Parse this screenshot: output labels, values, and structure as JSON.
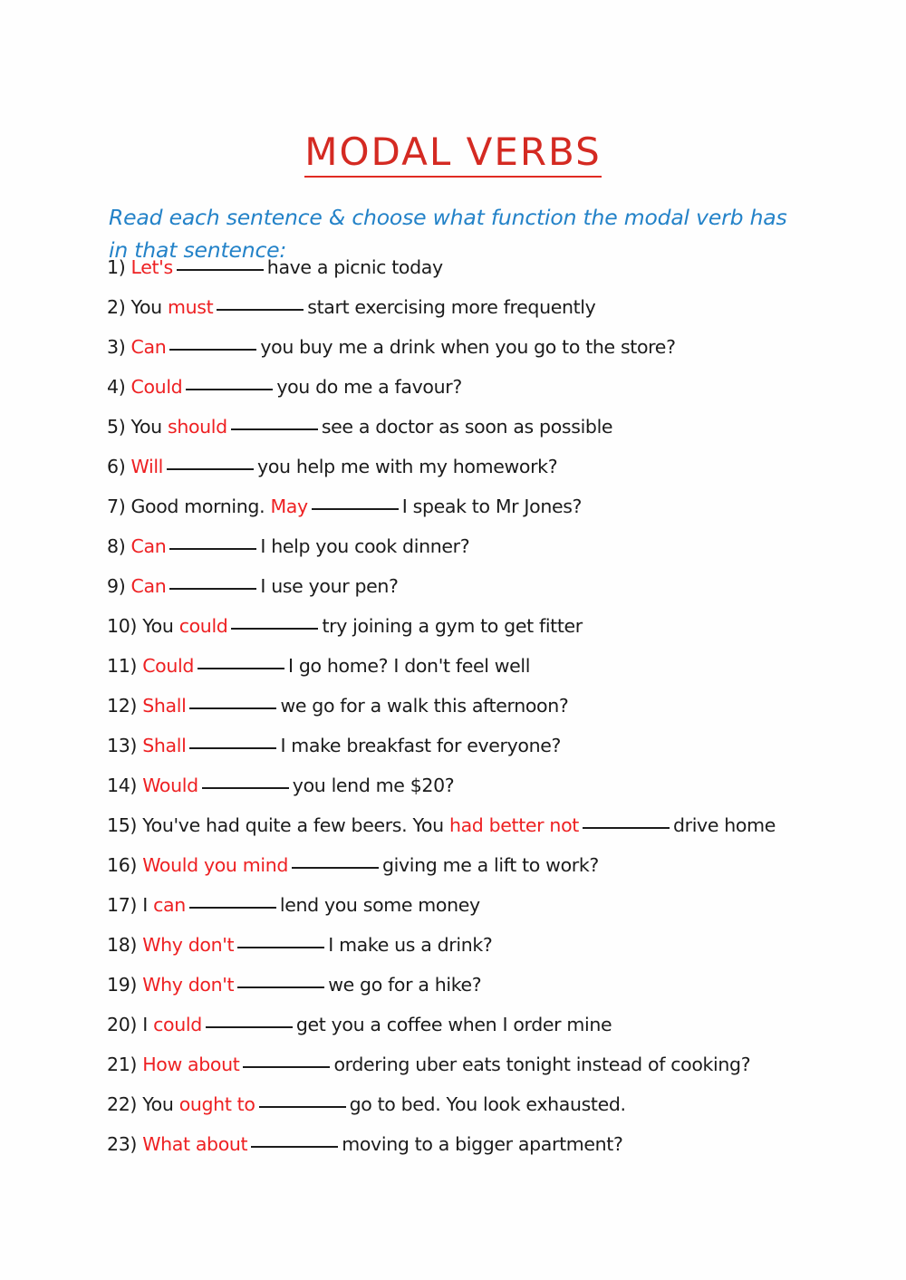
{
  "document": {
    "title": "MODAL VERBS",
    "instructions": "Read each sentence & choose what function the modal verb has in that sentence:",
    "colors": {
      "title_red": "#d42a22",
      "modal_red": "#ee2022",
      "instruction_blue": "#2382c8",
      "body_black": "#1b1b1b",
      "page_background": "#fefefe"
    },
    "blank_placeholder": "___________"
  },
  "questions": [
    {
      "num": "1)",
      "pre": "",
      "modal": "Let's",
      "post": "have a picnic today"
    },
    {
      "num": "2)",
      "pre": "You",
      "modal": "must",
      "post": "start exercising more frequently"
    },
    {
      "num": "3)",
      "pre": "",
      "modal": "Can",
      "post": "you buy me a drink when you go to the store?"
    },
    {
      "num": "4)",
      "pre": "",
      "modal": "Could",
      "post": "you do me a favour?"
    },
    {
      "num": "5)",
      "pre": "You",
      "modal": "should",
      "post": "see a doctor as soon as possible"
    },
    {
      "num": "6)",
      "pre": "",
      "modal": "Will",
      "post": "you help me with my homework?"
    },
    {
      "num": "7)",
      "pre": "Good morning.",
      "modal": "May",
      "post": "I speak to Mr Jones?"
    },
    {
      "num": "8)",
      "pre": "",
      "modal": "Can",
      "post": "I help you cook dinner?"
    },
    {
      "num": "9)",
      "pre": "",
      "modal": "Can",
      "post": "I use your pen?"
    },
    {
      "num": "10)",
      "pre": "You",
      "modal": "could",
      "post": "try joining a gym to get fitter"
    },
    {
      "num": "11)",
      "pre": "",
      "modal": "Could",
      "post": "I go home?  I don't feel well"
    },
    {
      "num": "12)",
      "pre": "",
      "modal": "Shall",
      "post": "we go for a walk this afternoon?"
    },
    {
      "num": "13)",
      "pre": "",
      "modal": "Shall",
      "post": "I make breakfast for everyone?"
    },
    {
      "num": "14)",
      "pre": "",
      "modal": "Would",
      "post": "you lend me $20?"
    },
    {
      "num": "15)",
      "pre": "You've had quite a few beers.  You",
      "modal": "had better not",
      "post": "drive home"
    },
    {
      "num": "16)",
      "pre": "",
      "modal": "Would you mind",
      "post": "giving me a lift to work?"
    },
    {
      "num": "17)",
      "pre": "I",
      "modal": "can",
      "post": "lend you some money"
    },
    {
      "num": "18)",
      "pre": "",
      "modal": "Why don't",
      "post": "I make us a drink?"
    },
    {
      "num": "19)",
      "pre": "",
      "modal": "Why don't",
      "post": "we go for a hike?"
    },
    {
      "num": "20)",
      "pre": "I",
      "modal": "could",
      "post": "get you a coffee when I order mine"
    },
    {
      "num": "21)",
      "pre": "",
      "modal": "How about",
      "post": "ordering uber eats tonight instead of cooking?"
    },
    {
      "num": "22)",
      "pre": "You",
      "modal": "ought to",
      "post": "go to bed.  You look exhausted."
    },
    {
      "num": "23)",
      "pre": "",
      "modal": "What about",
      "post": "moving to a bigger apartment?"
    }
  ]
}
